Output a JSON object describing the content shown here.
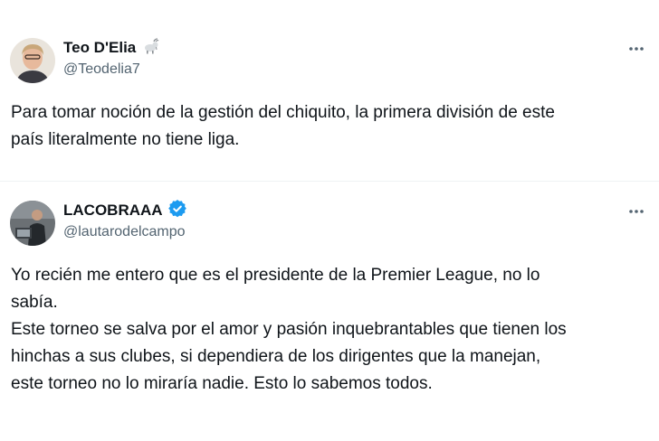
{
  "tweets": [
    {
      "display_name": "Teo D'Elia",
      "name_emoji_icon": "goat-icon",
      "handle": "@Teodelia7",
      "text": "Para tomar noción de la gestión del chiquito, la primera división de este\npaís literalmente no tiene liga."
    },
    {
      "display_name": "LACOBRAAA",
      "badge_icon": "verified-badge-icon",
      "handle": "@lautarodelcampo",
      "text": "Yo recién me entero que es el presidente de la Premier League, no lo\nsabía.\nEste torneo se salva por el amor y pasión inquebrantables que tienen los\nhinchas a sus clubes, si dependiera de los dirigentes que la manejan,\neste torneo no lo miraría nadie. Esto lo sabemos todos."
    }
  ],
  "colors": {
    "text_primary": "#0f1419",
    "text_secondary": "#536471",
    "verified_blue": "#1d9bf0",
    "divider": "#eff3f4"
  }
}
